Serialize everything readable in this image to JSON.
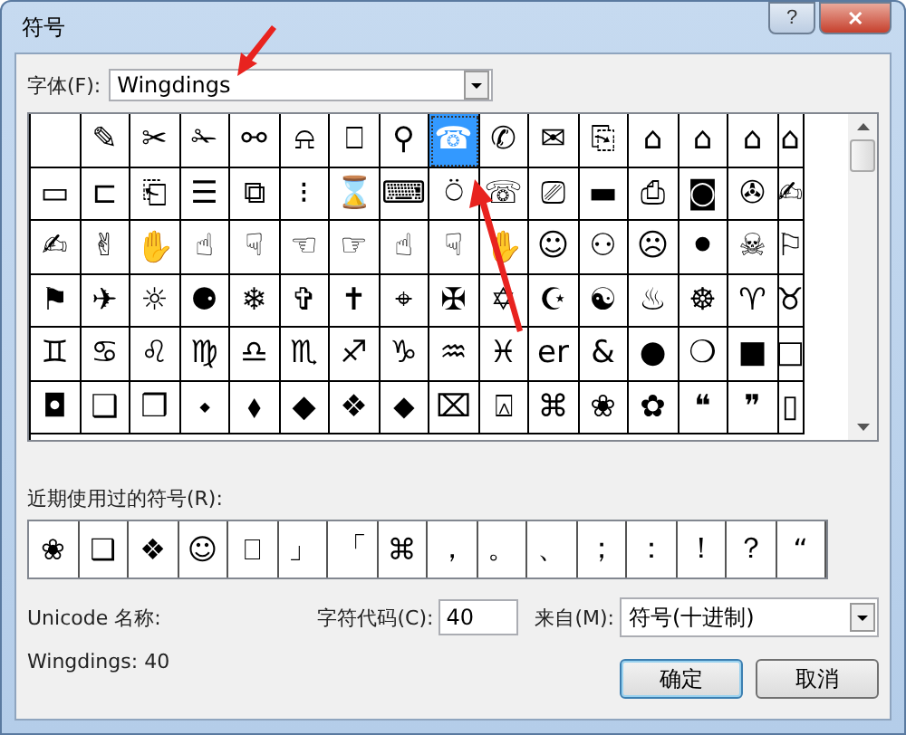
{
  "window": {
    "title": "符号",
    "help_button": "?",
    "close_button": "✕"
  },
  "font": {
    "label": "字体(F):",
    "value": "Wingdings"
  },
  "grid": {
    "rows": [
      [
        {
          "selected": false
        },
        {
          "glyph": "✎",
          "selected": false
        },
        {
          "glyph": "✂",
          "selected": false
        },
        {
          "glyph": "✁",
          "selected": false
        },
        {
          "glyph": "⚯",
          "selected": false
        },
        {
          "glyph": "⍾",
          "selected": false
        },
        {
          "glyph": "⎕",
          "selected": false
        },
        {
          "glyph": "⚲",
          "selected": false
        },
        {
          "glyph": "☎",
          "selected": true
        },
        {
          "glyph": "✆",
          "selected": false
        },
        {
          "glyph": "✉",
          "selected": false
        },
        {
          "glyph": "⎘",
          "selected": false
        },
        {
          "glyph": "⌂",
          "selected": false
        },
        {
          "glyph": "⌂",
          "selected": false
        },
        {
          "glyph": "⌂",
          "selected": false
        },
        {
          "glyph": "⌂",
          "selected": false
        }
      ],
      [
        {
          "glyph": "▭",
          "selected": false
        },
        {
          "glyph": "⊏",
          "selected": false
        },
        {
          "glyph": "⎗",
          "selected": false
        },
        {
          "glyph": "☰",
          "selected": false
        },
        {
          "glyph": "⧉",
          "selected": false
        },
        {
          "glyph": "⁝",
          "selected": false
        },
        {
          "glyph": "⌛",
          "selected": false
        },
        {
          "glyph": "⌨",
          "selected": false
        },
        {
          "glyph": "⍥",
          "selected": false
        },
        {
          "glyph": "☏",
          "selected": false
        },
        {
          "glyph": "⎚",
          "selected": false
        },
        {
          "glyph": "▬",
          "selected": false
        },
        {
          "glyph": "⎙",
          "selected": false
        },
        {
          "glyph": "◙",
          "selected": false
        },
        {
          "glyph": "✇",
          "selected": false
        },
        {
          "glyph": "✍",
          "selected": false
        }
      ],
      [
        {
          "glyph": "✍",
          "selected": false
        },
        {
          "glyph": "✌",
          "selected": false
        },
        {
          "glyph": "✋",
          "selected": false
        },
        {
          "glyph": "☝",
          "selected": false
        },
        {
          "glyph": "☟",
          "selected": false
        },
        {
          "glyph": "☜",
          "selected": false
        },
        {
          "glyph": "☞",
          "selected": false
        },
        {
          "glyph": "☝",
          "selected": false
        },
        {
          "glyph": "☟",
          "selected": false
        },
        {
          "glyph": "✋",
          "selected": false
        },
        {
          "glyph": "☺",
          "selected": false
        },
        {
          "glyph": "⚇",
          "selected": false
        },
        {
          "glyph": "☹",
          "selected": false
        },
        {
          "glyph": "⚫",
          "selected": false
        },
        {
          "glyph": "☠",
          "selected": false
        },
        {
          "glyph": "⚐",
          "selected": false
        }
      ],
      [
        {
          "glyph": "⚑",
          "selected": false
        },
        {
          "glyph": "✈",
          "selected": false
        },
        {
          "glyph": "☼",
          "selected": false
        },
        {
          "glyph": "⚈",
          "selected": false
        },
        {
          "glyph": "❄",
          "selected": false
        },
        {
          "glyph": "✞",
          "selected": false
        },
        {
          "glyph": "✝",
          "selected": false
        },
        {
          "glyph": "⌖",
          "selected": false
        },
        {
          "glyph": "✠",
          "selected": false
        },
        {
          "glyph": "✡",
          "selected": false
        },
        {
          "glyph": "☪",
          "selected": false
        },
        {
          "glyph": "☯",
          "selected": false
        },
        {
          "glyph": "♨",
          "selected": false
        },
        {
          "glyph": "☸",
          "selected": false
        },
        {
          "glyph": "♈",
          "selected": false
        },
        {
          "glyph": "♉",
          "selected": false
        }
      ],
      [
        {
          "glyph": "♊",
          "selected": false
        },
        {
          "glyph": "♋",
          "selected": false
        },
        {
          "glyph": "♌",
          "selected": false
        },
        {
          "glyph": "♍",
          "selected": false
        },
        {
          "glyph": "♎",
          "selected": false
        },
        {
          "glyph": "♏",
          "selected": false
        },
        {
          "glyph": "♐",
          "selected": false
        },
        {
          "glyph": "♑",
          "selected": false
        },
        {
          "glyph": "♒",
          "selected": false
        },
        {
          "glyph": "♓",
          "selected": false
        },
        {
          "glyph": "er",
          "selected": false
        },
        {
          "glyph": "&",
          "selected": false
        },
        {
          "glyph": "●",
          "selected": false
        },
        {
          "glyph": "❍",
          "selected": false
        },
        {
          "glyph": "■",
          "selected": false
        },
        {
          "glyph": "□",
          "selected": false
        }
      ],
      [
        {
          "glyph": "◘",
          "selected": false
        },
        {
          "glyph": "❑",
          "selected": false
        },
        {
          "glyph": "❒",
          "selected": false
        },
        {
          "glyph": "⬩",
          "selected": false
        },
        {
          "glyph": "⬧",
          "selected": false
        },
        {
          "glyph": "◆",
          "selected": false
        },
        {
          "glyph": "❖",
          "selected": false
        },
        {
          "glyph": "⬥",
          "selected": false
        },
        {
          "glyph": "⌧",
          "selected": false
        },
        {
          "glyph": "⍓",
          "selected": false
        },
        {
          "glyph": "⌘",
          "selected": false
        },
        {
          "glyph": "❀",
          "selected": false
        },
        {
          "glyph": "✿",
          "selected": false
        },
        {
          "glyph": "❝",
          "selected": false
        },
        {
          "glyph": "❞",
          "selected": false
        },
        {
          "glyph": "▯",
          "selected": false
        }
      ]
    ]
  },
  "recent": {
    "label": "近期使用过的符号(R):",
    "symbols": [
      "❀",
      "❑",
      "❖",
      "☺",
      "⎕",
      "」",
      "「",
      "⌘",
      "，",
      "。",
      "、",
      "；",
      "：",
      "！",
      "？",
      "“"
    ]
  },
  "unicode_name_label": "Unicode 名称:",
  "symbol_info": "Wingdings: 40",
  "char_code": {
    "label": "字符代码(C):",
    "value": "40"
  },
  "from": {
    "label": "来自(M):",
    "value": "符号(十进制)"
  },
  "buttons": [
    {
      "label": "确定",
      "default": true
    },
    {
      "label": "取消",
      "default": false
    }
  ]
}
